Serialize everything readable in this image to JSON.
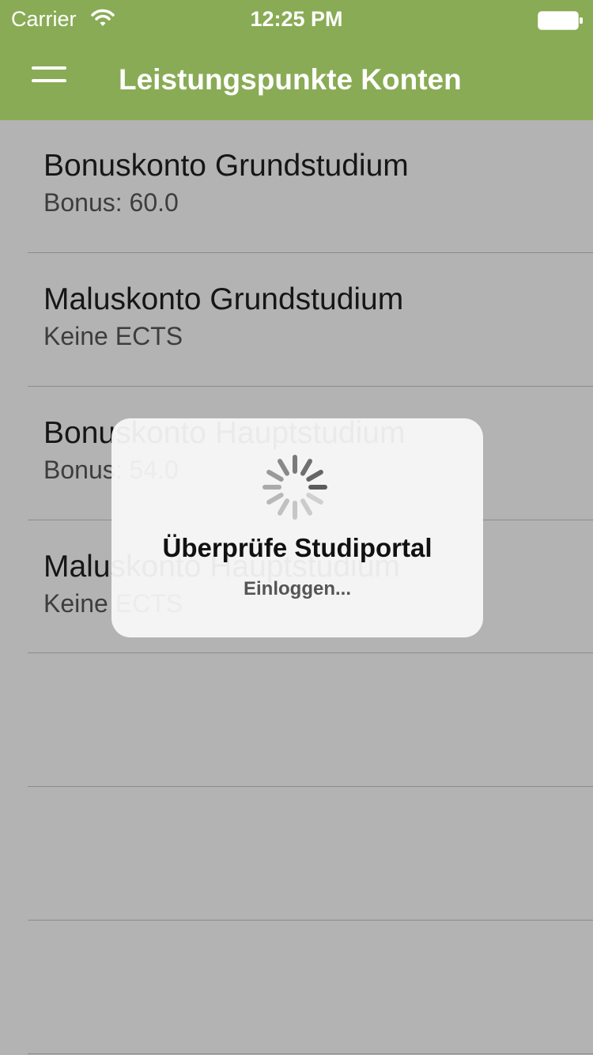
{
  "status_bar": {
    "carrier": "Carrier",
    "time": "12:25 PM",
    "wifi_icon": "wifi-icon",
    "battery_icon": "battery-full-icon"
  },
  "nav": {
    "title": "Leistungspunkte Konten",
    "menu_icon": "hamburger-menu-icon",
    "color": "#89ab55"
  },
  "accounts": [
    {
      "title": "Bonuskonto Grundstudium",
      "subtitle": "Bonus: 60.0"
    },
    {
      "title": "Maluskonto Grundstudium",
      "subtitle": "Keine ECTS"
    },
    {
      "title": "Bonuskonto Hauptstudium",
      "subtitle": "Bonus: 54.0"
    },
    {
      "title": "Maluskonto Hauptstudium",
      "subtitle": "Keine ECTS"
    }
  ],
  "progress_hud": {
    "title": "Überprüfe Studiportal",
    "subtitle": "Einloggen...",
    "spinner_icon": "activity-spinner-icon"
  }
}
